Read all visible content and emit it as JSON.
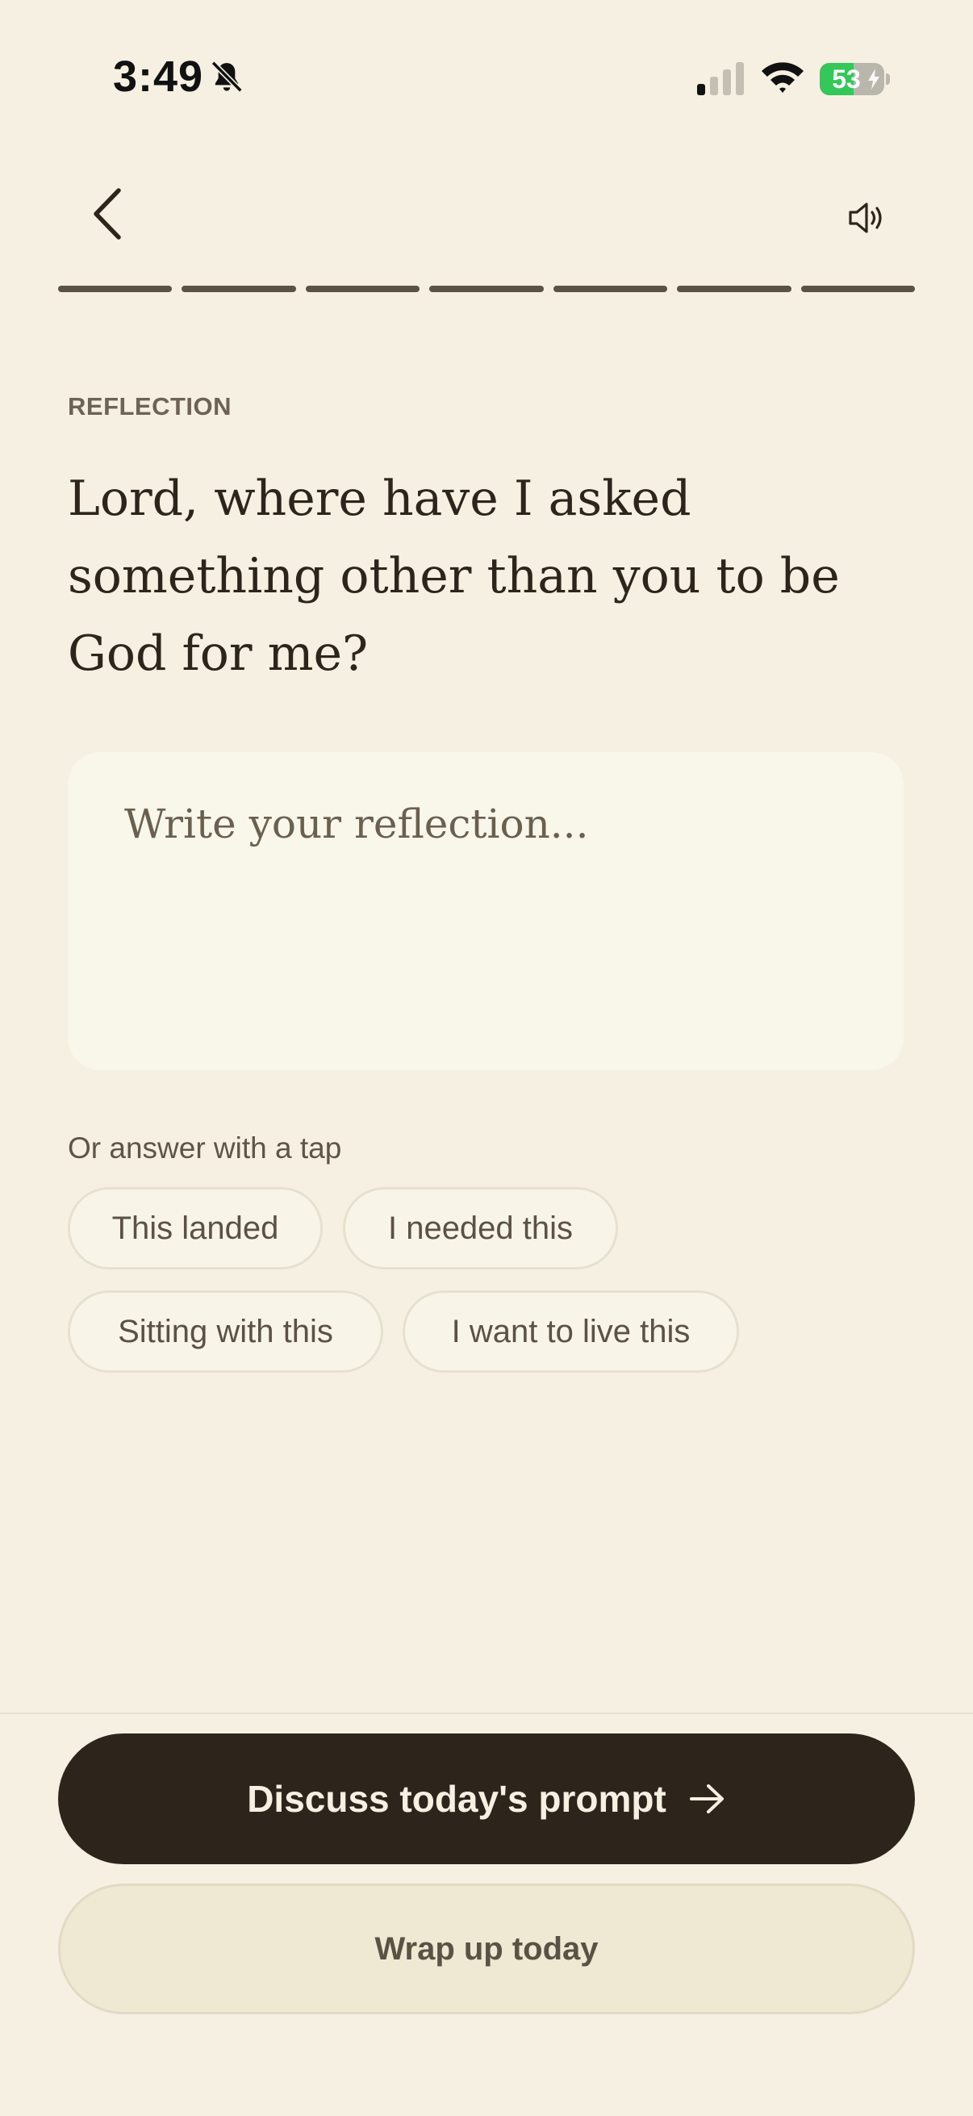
{
  "status_bar": {
    "time": "3:49",
    "battery_level": "53",
    "icons": [
      "bell-slash-icon",
      "cellular-signal-icon",
      "wifi-icon",
      "battery-charging-icon"
    ]
  },
  "nav": {
    "back_icon": "chevron-left-icon",
    "speaker_icon": "speaker-icon",
    "progress": {
      "total_steps": 7,
      "completed_steps": 7
    }
  },
  "reflection": {
    "section_label": "REFLECTION",
    "prompt": "Lord, where have I asked something other than you to be God for me?",
    "input_placeholder": "Write your reflection...",
    "input_value": ""
  },
  "quick_answers": {
    "label": "Or answer with a tap",
    "options": [
      "This landed",
      "I needed this",
      "Sitting with this",
      "I want to live this"
    ]
  },
  "actions": {
    "primary_label": "Discuss today's prompt",
    "primary_icon": "arrow-right-icon",
    "secondary_label": "Wrap up today"
  },
  "colors": {
    "background": "#f5f0e2",
    "primary_button": "#2d251b",
    "progress": "#5b5144",
    "battery": "#34c759"
  }
}
